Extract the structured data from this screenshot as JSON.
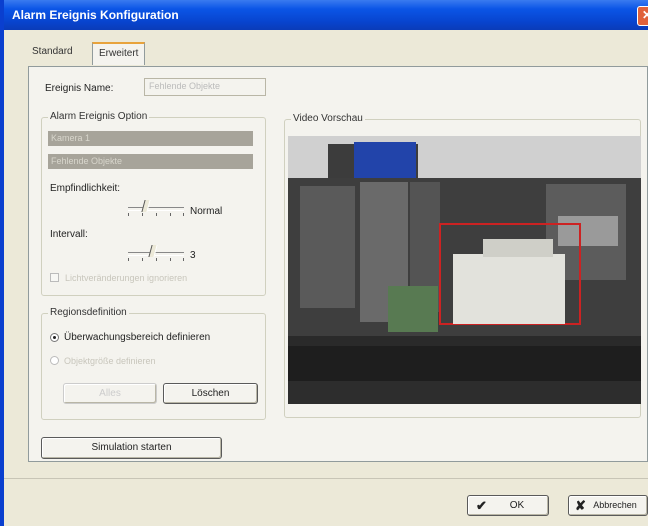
{
  "window": {
    "title": "Alarm Ereignis Konfiguration",
    "close_glyph": "✕"
  },
  "tabs": [
    {
      "label": "Standard"
    },
    {
      "label": "Erweitert"
    }
  ],
  "event_name": {
    "label": "Ereignis Name:",
    "value": "Fehlende Objekte"
  },
  "alarm_option": {
    "title": "Alarm Ereignis Option",
    "camera": "Kamera 1",
    "event_type": "Fehlende Objekte",
    "sensitivity_label": "Empfindlichkeit:",
    "sensitivity_value": "Normal",
    "interval_label": "Intervall:",
    "interval_value": "3",
    "checkbox_label": "Lichtveränderungen ignorieren"
  },
  "region": {
    "title": "Regionsdefinition",
    "option_define": "Überwachungsbereich definieren",
    "option_other": "Objektgröße definieren",
    "button_all": "Alles",
    "button_delete": "Löschen"
  },
  "preview": {
    "title": "Video Vorschau"
  },
  "simulation_button": "Simulation starten",
  "footer": {
    "ok": "OK",
    "cancel": "Abbrechen"
  }
}
